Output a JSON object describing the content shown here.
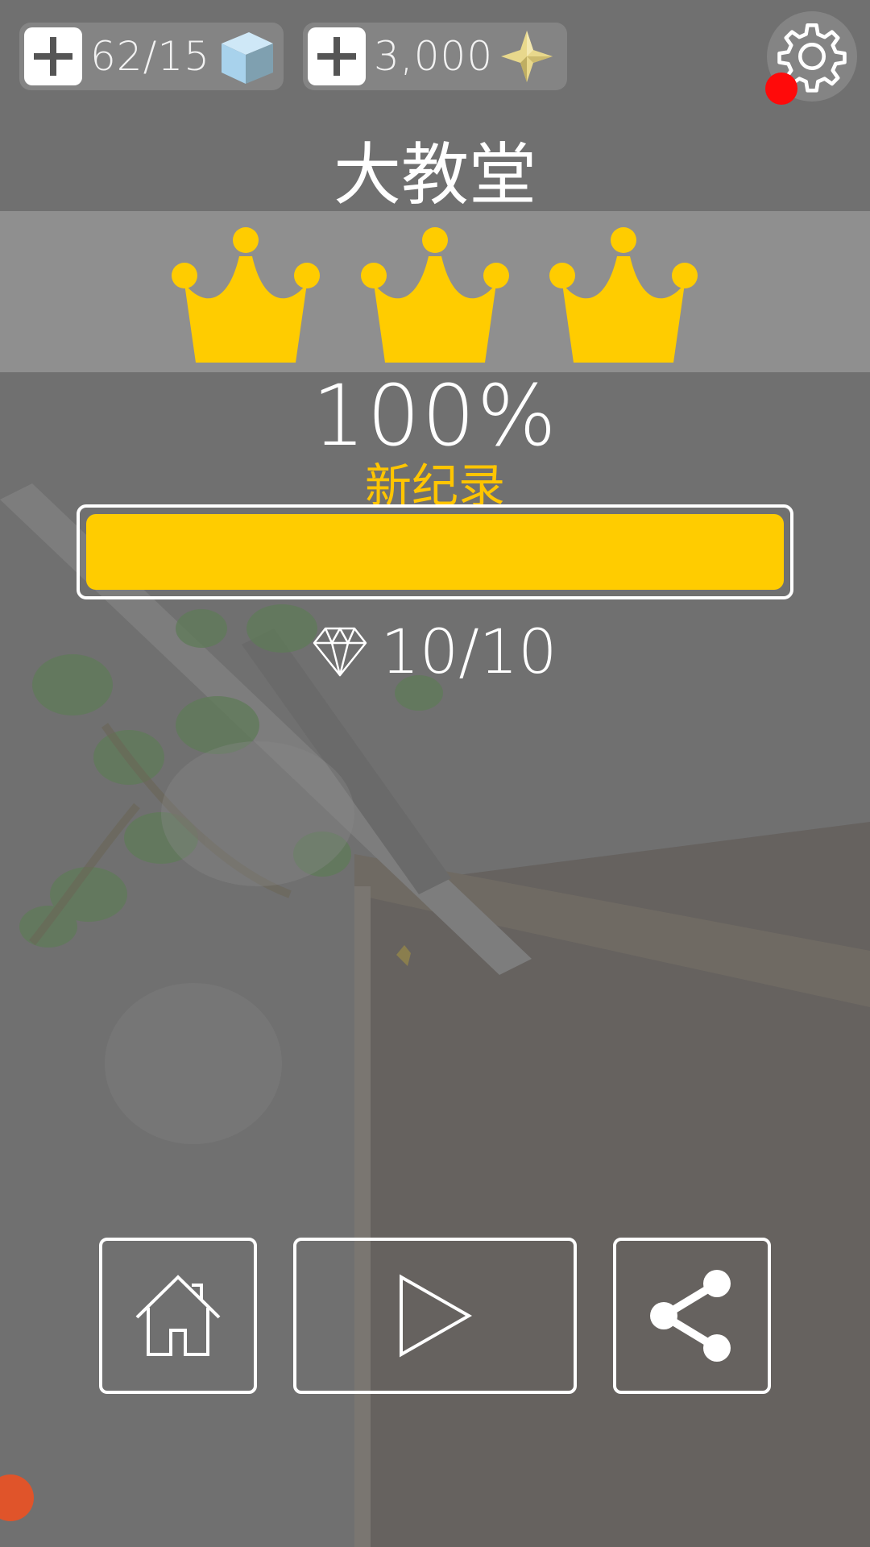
{
  "topbar": {
    "cubes": {
      "count": "62/15",
      "plus_icon": "plus-icon",
      "icon": "ice-cube-icon"
    },
    "stars": {
      "count": "3,000",
      "plus_icon": "plus-icon",
      "icon": "gold-star-icon"
    },
    "settings_icon": "gear-icon",
    "notification_dot": true
  },
  "level": {
    "title": "大教堂",
    "crowns_earned": 3,
    "crowns_total": 3,
    "percent_text": "100%",
    "record_text": "新纪录",
    "progress_fraction": 1.0
  },
  "gems": {
    "icon": "diamond-icon",
    "text": "10/10"
  },
  "actions": [
    {
      "name": "home",
      "icon": "home-icon"
    },
    {
      "name": "play",
      "icon": "play-icon"
    },
    {
      "name": "share",
      "icon": "share-icon"
    }
  ],
  "colors": {
    "accent_gold": "#ffcc00",
    "record_text": "#ffc500",
    "notification": "#ff0a0a",
    "crown_band": "#8f8f8f",
    "overlay_gray": "#6f6f6f"
  }
}
